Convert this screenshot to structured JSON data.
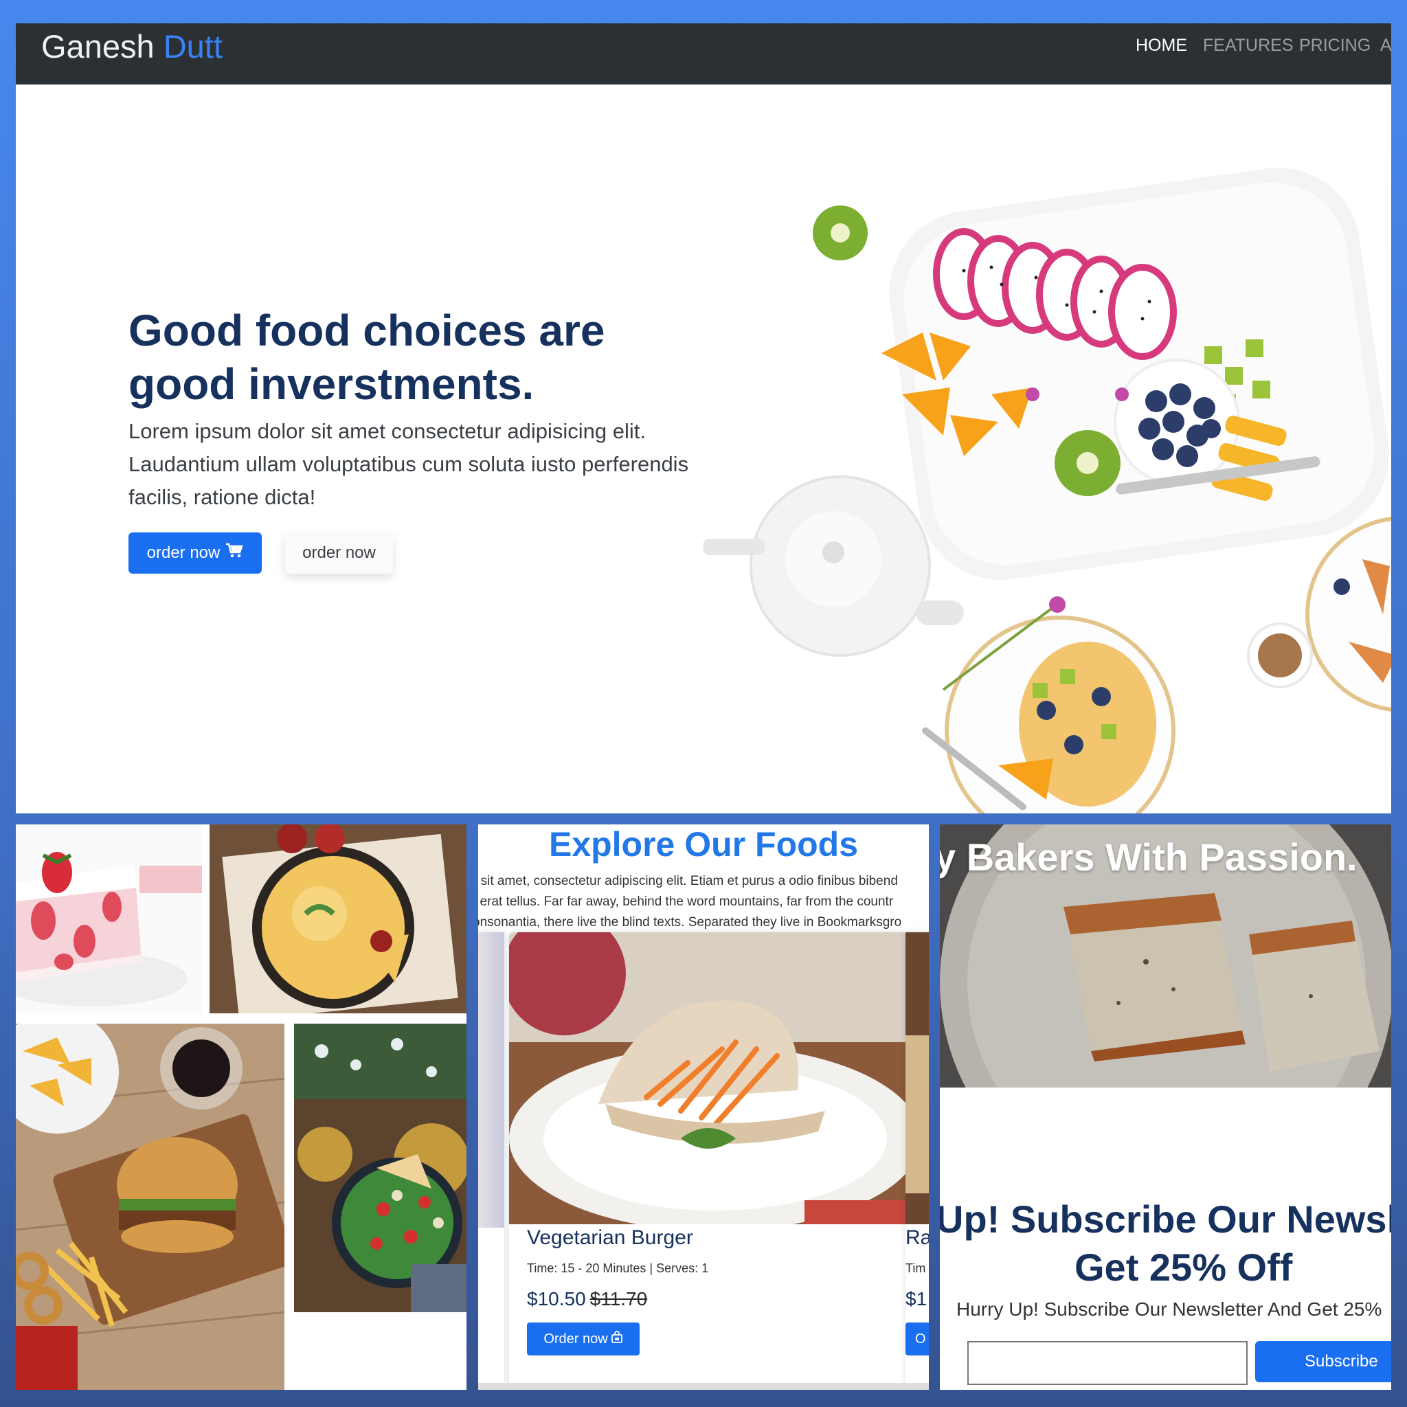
{
  "navbar": {
    "brand_first": "Ganesh",
    "brand_second": "Dutt",
    "links": [
      "HOME",
      "FEATURES",
      "PRICING",
      "A"
    ],
    "active_link": "HOME"
  },
  "hero": {
    "title": "Good food choices are good inverstments.",
    "text": "Lorem ipsum dolor sit amet consectetur adipisicing elit. Laudantium ullam voluptatibus cum soluta iusto perferendis facilis, ratione dicta!",
    "primary_button": "order now",
    "secondary_button": "order now",
    "primary_button_icon": "cart-icon"
  },
  "gallery": {
    "images": [
      "strawberry-cake-photo",
      "pie-photo",
      "fast-food-photo",
      "salad-bowl-photo"
    ]
  },
  "explore": {
    "title": "Explore Our Foods",
    "text_lines": [
      "r sit amet, consectetur adipiscing elit. Etiam et purus a odio finibus bibend",
      "t erat tellus. Far far away, behind the word mountains, far from the countr",
      "onsonantia, there live the blind texts. Separated they live in Bookmarksgro"
    ],
    "card": {
      "title": "Vegetarian Burger",
      "meta": "Time: 15 - 20 Minutes | Serves: 1",
      "price": "$10.50",
      "old_price": "$11.70",
      "button": "Order now",
      "button_icon": "bag-icon"
    },
    "next_card": {
      "title": "Ra",
      "meta": "Tim",
      "price": "$1",
      "button": "O"
    }
  },
  "newsletter": {
    "banner_heading": "y Bakers With Passion.",
    "title_line1": "Up! Subscribe Our Newsl",
    "title_line2": "Get 25% Off",
    "subtitle": "Hurry Up! Subscribe Our Newsletter And Get 25%",
    "input_value": "",
    "button": "Subscribe"
  },
  "colors": {
    "frame": "#4688ee",
    "navbar": "#2b3035",
    "accent": "#1a6ef0",
    "heading": "#16315d",
    "explore_title": "#2378e8"
  }
}
